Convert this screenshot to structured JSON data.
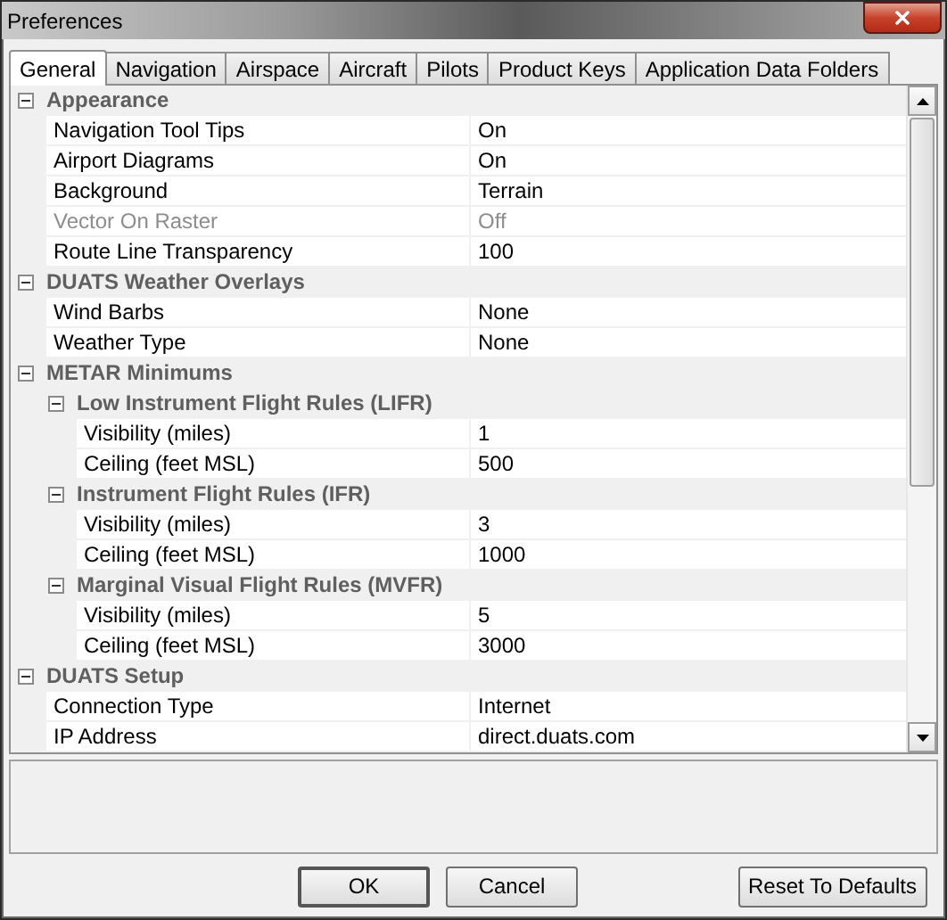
{
  "window": {
    "title": "Preferences"
  },
  "tabs": [
    {
      "label": "General",
      "selected": true
    },
    {
      "label": "Navigation",
      "selected": false
    },
    {
      "label": "Airspace",
      "selected": false
    },
    {
      "label": "Aircraft",
      "selected": false
    },
    {
      "label": "Pilots",
      "selected": false
    },
    {
      "label": "Product Keys",
      "selected": false
    },
    {
      "label": "Application Data Folders",
      "selected": false
    }
  ],
  "grid": {
    "items": [
      {
        "kind": "category",
        "label": "Appearance",
        "expanded": true,
        "children": [
          {
            "kind": "property",
            "label": "Navigation Tool Tips",
            "value": "On",
            "disabled": false
          },
          {
            "kind": "property",
            "label": "Airport Diagrams",
            "value": "On",
            "disabled": false
          },
          {
            "kind": "property",
            "label": "Background",
            "value": "Terrain",
            "disabled": false
          },
          {
            "kind": "property",
            "label": "Vector On Raster",
            "value": "Off",
            "disabled": true
          },
          {
            "kind": "property",
            "label": "Route Line Transparency",
            "value": "100",
            "disabled": false
          }
        ]
      },
      {
        "kind": "category",
        "label": "DUATS Weather Overlays",
        "expanded": true,
        "children": [
          {
            "kind": "property",
            "label": "Wind Barbs",
            "value": "None",
            "disabled": false
          },
          {
            "kind": "property",
            "label": "Weather Type",
            "value": "None",
            "disabled": false
          }
        ]
      },
      {
        "kind": "category",
        "label": "METAR Minimums",
        "expanded": true,
        "children": [
          {
            "kind": "category",
            "label": "Low Instrument Flight Rules (LIFR)",
            "expanded": true,
            "children": [
              {
                "kind": "property",
                "label": "Visibility (miles)",
                "value": "1",
                "disabled": false
              },
              {
                "kind": "property",
                "label": "Ceiling (feet MSL)",
                "value": "500",
                "disabled": false
              }
            ]
          },
          {
            "kind": "category",
            "label": "Instrument Flight Rules (IFR)",
            "expanded": true,
            "children": [
              {
                "kind": "property",
                "label": "Visibility (miles)",
                "value": "3",
                "disabled": false
              },
              {
                "kind": "property",
                "label": "Ceiling (feet MSL)",
                "value": "1000",
                "disabled": false
              }
            ]
          },
          {
            "kind": "category",
            "label": "Marginal Visual Flight Rules (MVFR)",
            "expanded": true,
            "children": [
              {
                "kind": "property",
                "label": "Visibility (miles)",
                "value": "5",
                "disabled": false
              },
              {
                "kind": "property",
                "label": "Ceiling (feet MSL)",
                "value": "3000",
                "disabled": false
              }
            ]
          }
        ]
      },
      {
        "kind": "category",
        "label": "DUATS Setup",
        "expanded": true,
        "children": [
          {
            "kind": "property",
            "label": "Connection Type",
            "value": "Internet",
            "disabled": false
          },
          {
            "kind": "property",
            "label": "IP Address",
            "value": "direct.duats.com",
            "disabled": false
          }
        ]
      }
    ]
  },
  "buttons": [
    {
      "label": "OK",
      "kind": "default"
    },
    {
      "label": "Cancel",
      "kind": "normal"
    },
    {
      "label": "Reset To Defaults",
      "kind": "normal"
    }
  ]
}
